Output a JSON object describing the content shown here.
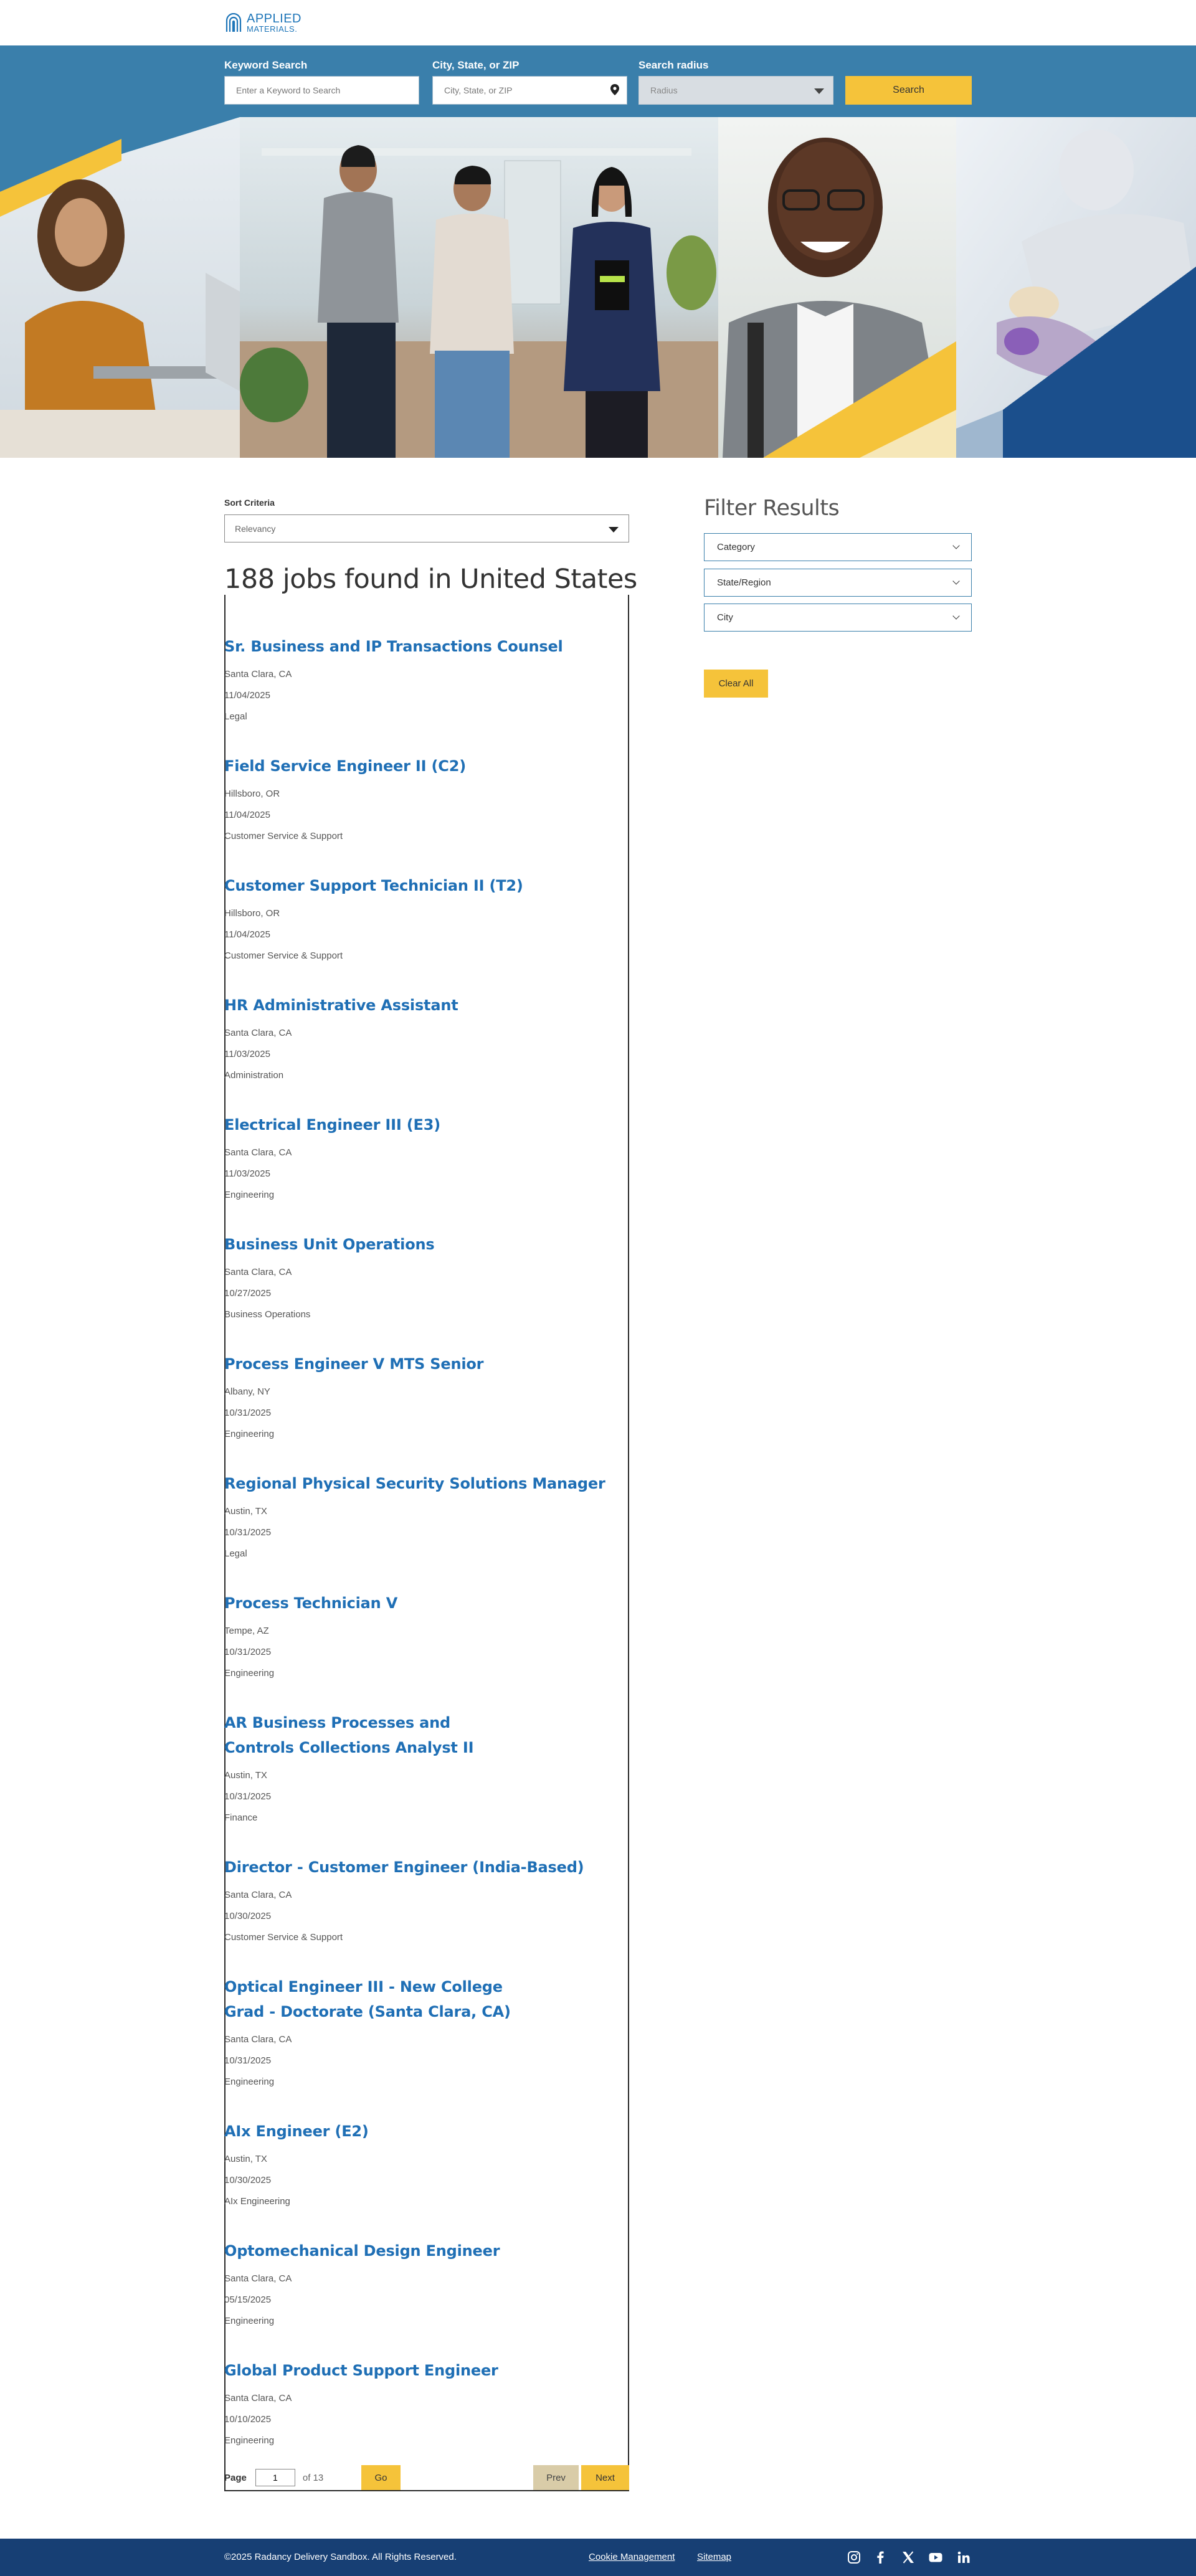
{
  "header": {
    "logo_line1": "APPLIED",
    "logo_line2": "MATERIALS."
  },
  "search": {
    "keyword_label": "Keyword Search",
    "keyword_placeholder": "Enter a Keyword to Search",
    "location_label": "City, State, or ZIP",
    "location_placeholder": "City, State, or ZIP",
    "radius_label": "Search radius",
    "radius_value": "Radius",
    "search_button": "Search"
  },
  "sort": {
    "label": "Sort Criteria",
    "value": "Relevancy"
  },
  "results": {
    "title": "188 jobs found in United States",
    "jobs": [
      {
        "title": "Sr. Business and IP Transactions Counsel",
        "location": "Santa Clara, CA",
        "date": "11/04/2025",
        "category": "Legal"
      },
      {
        "title": "Field Service Engineer II (C2)",
        "location": "Hillsboro, OR",
        "date": "11/04/2025",
        "category": "Customer Service & Support"
      },
      {
        "title": "Customer Support Technician II (T2)",
        "location": "Hillsboro, OR",
        "date": "11/04/2025",
        "category": "Customer Service & Support"
      },
      {
        "title": "HR Administrative Assistant",
        "location": "Santa Clara, CA",
        "date": "11/03/2025",
        "category": "Administration"
      },
      {
        "title": "Electrical Engineer III (E3)",
        "location": "Santa Clara, CA",
        "date": "11/03/2025",
        "category": "Engineering"
      },
      {
        "title": "Business Unit Operations",
        "location": "Santa Clara, CA",
        "date": "10/27/2025",
        "category": "Business Operations"
      },
      {
        "title": "Process Engineer V MTS Senior",
        "location": "Albany, NY",
        "date": "10/31/2025",
        "category": "Engineering"
      },
      {
        "title": "Regional Physical Security Solutions Manager",
        "location": "Austin, TX",
        "date": "10/31/2025",
        "category": "Legal"
      },
      {
        "title": "Process Technician V",
        "location": "Tempe, AZ",
        "date": "10/31/2025",
        "category": "Engineering"
      },
      {
        "title_line1": "AR Business Processes and",
        "title_line2": "Controls Collections Analyst II",
        "location": "Austin, TX",
        "date": "10/31/2025",
        "category": "Finance"
      },
      {
        "title": "Director - Customer Engineer (India-Based)",
        "location": "Santa Clara, CA",
        "date": "10/30/2025",
        "category": "Customer Service & Support"
      },
      {
        "title_line1": "Optical Engineer III - New College",
        "title_line2": "Grad - Doctorate (Santa Clara, CA)",
        "location": "Santa Clara, CA",
        "date": "10/31/2025",
        "category": "Engineering"
      },
      {
        "title": "AIx Engineer (E2)",
        "location": "Austin, TX",
        "date": "10/30/2025",
        "category": "AIx Engineering"
      },
      {
        "title": "Optomechanical Design Engineer",
        "location": "Santa Clara, CA",
        "date": "05/15/2025",
        "category": "Engineering"
      },
      {
        "title": "Global Product Support Engineer",
        "location": "Santa Clara, CA",
        "date": "10/10/2025",
        "category": "Engineering"
      }
    ]
  },
  "pagination": {
    "page_label": "Page",
    "current_page": "1",
    "of_text": "of 13",
    "go_button": "Go",
    "prev_button": "Prev",
    "next_button": "Next"
  },
  "filters": {
    "heading": "Filter Results",
    "category": "Category",
    "state_region": "State/Region",
    "city": "City",
    "clear_all": "Clear All"
  },
  "footer": {
    "copyright": "©2025 Radancy Delivery Sandbox. All Rights Reserved.",
    "cookie_link": "Cookie Management",
    "sitemap_link": "Sitemap",
    "social_icons": [
      "instagram-icon",
      "facebook-icon",
      "x-icon",
      "youtube-icon",
      "linkedin-icon"
    ]
  },
  "colors": {
    "brand_blue": "#3a7fab",
    "link_blue": "#1f6fb5",
    "accent_yellow": "#f5c33a",
    "footer_navy": "#173f74"
  }
}
